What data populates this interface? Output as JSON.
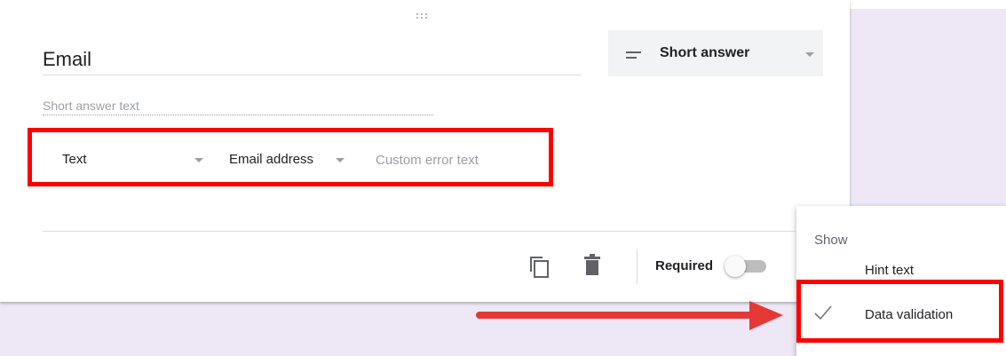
{
  "question": {
    "title": "Email",
    "type_label": "Short answer",
    "answer_placeholder": "Short answer text",
    "drag_handle": "⠿"
  },
  "validation": {
    "type": "Text",
    "subtype": "Email address",
    "error_placeholder": "Custom error text"
  },
  "footer": {
    "required_label": "Required",
    "required_on": false
  },
  "menu": {
    "header": "Show",
    "items": [
      {
        "label": "Hint text",
        "checked": false
      },
      {
        "label": "Data validation",
        "checked": true
      }
    ]
  },
  "colors": {
    "highlight": "#ff0000",
    "arrow": "#e53935",
    "background": "#ede7f6"
  },
  "icons": [
    "drag-handle-icon",
    "short-answer-lines-icon",
    "copy-icon",
    "trash-icon",
    "check-icon",
    "arrow-icon"
  ]
}
